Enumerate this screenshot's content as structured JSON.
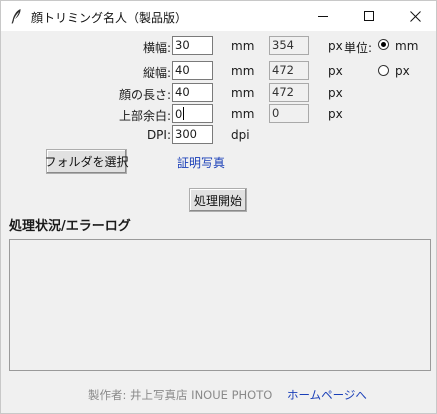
{
  "window": {
    "title": "顔トリミング名人（製品版）",
    "controls": {
      "minimize": "minimize-icon",
      "maximize": "maximize-icon",
      "close": "close-icon"
    }
  },
  "form": {
    "width": {
      "label": "横幅:",
      "value": "30",
      "unit": "mm",
      "px_value": "354",
      "px_unit": "px"
    },
    "height": {
      "label": "縦幅:",
      "value": "40",
      "unit": "mm",
      "px_value": "472",
      "px_unit": "px"
    },
    "face": {
      "label": "顔の長さ:",
      "value": "40",
      "unit": "mm",
      "px_value": "472",
      "px_unit": "px"
    },
    "top": {
      "label": "上部余白:",
      "value": "0",
      "unit": "mm",
      "px_value": "0",
      "px_unit": "px"
    },
    "dpi": {
      "label": "DPI:",
      "value": "300",
      "unit": "dpi"
    }
  },
  "unit_select": {
    "label": "単位:",
    "options": [
      {
        "label": "mm",
        "selected": true
      },
      {
        "label": "px",
        "selected": false
      }
    ]
  },
  "folder_button": "フォルダを選択",
  "folder_name": "証明写真",
  "start_button": "処理開始",
  "log_heading": "処理状況/エラーログ",
  "log_text": "",
  "footer": {
    "credit": "製作者: 井上写真店 INOUE PHOTO",
    "homepage_link": "ホームページへ"
  },
  "colors": {
    "link": "#1a3fb8",
    "footer_gray": "#8a8a8a",
    "window_bg": "#f0f0f0"
  }
}
